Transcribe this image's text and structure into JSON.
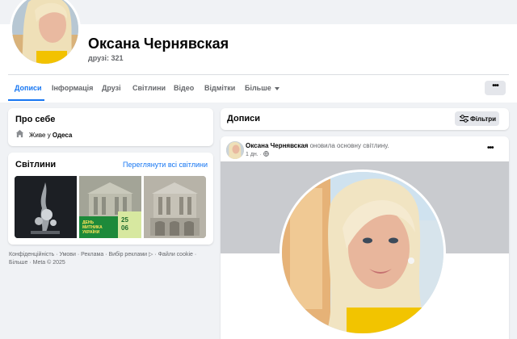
{
  "profile": {
    "name": "Оксана Чернявская",
    "friends": "друзі: 321"
  },
  "tabs": [
    {
      "label": "Дописи",
      "active": true
    },
    {
      "label": "Інформація"
    },
    {
      "label": "Друзі"
    },
    {
      "label": "Світлини"
    },
    {
      "label": "Відео"
    },
    {
      "label": "Відмітки"
    },
    {
      "label": "Більше"
    }
  ],
  "more_menu_label": "•••",
  "about": {
    "title": "Про себе",
    "lives_prefix": "Живе у",
    "lives_city": "Одеса",
    "icon": "home-icon"
  },
  "highlights": {
    "title": "Світлини",
    "see_all": "Переглянути всі світлини",
    "thumb2_text_line1": "ДЕНЬ",
    "thumb2_text_line2": "МИТНИКА",
    "thumb2_text_line3": "УКРАЇНИ",
    "thumb2_date_day": "25",
    "thumb2_date_month": "06"
  },
  "footer": {
    "text": "Конфіденційність · Умови · Реклама · Вибір реклами ▷ · Файли cookie · Більше · Meta © 2025"
  },
  "posts": {
    "title": "Дописи",
    "filter_label": "Фільтри"
  },
  "post": {
    "author": "Оксана Чернявская",
    "action": "оновила основну світлину.",
    "time": "1 дн.",
    "audience_icon": "globe-icon",
    "menu": "•••"
  },
  "colors": {
    "accent": "#1877f2",
    "background": "#f0f2f5",
    "secondary_text": "#65676b"
  }
}
